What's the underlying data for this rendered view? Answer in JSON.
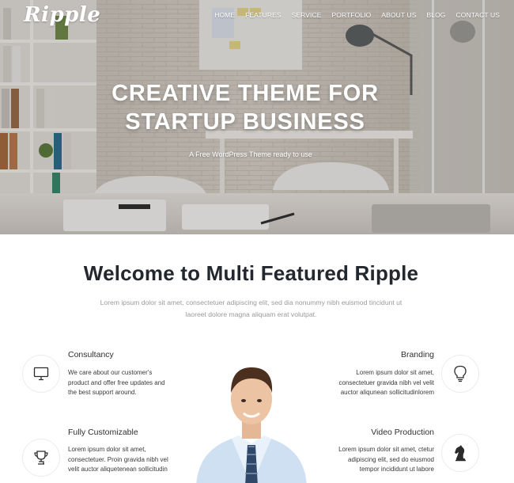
{
  "brand": {
    "logo": "Ripple"
  },
  "nav": [
    "HOME",
    "FEATURES",
    "SERVICE",
    "PORTFOLIO",
    "ABOUT US",
    "BLOG",
    "CONTACT US"
  ],
  "hero": {
    "title_line1": "CREATIVE THEME FOR",
    "title_line2": "STARTUP BUSINESS",
    "subtitle": "A Free WordPress Theme ready to use"
  },
  "welcome": {
    "title": "Welcome to Multi Featured Ripple",
    "text": "Lorem ipsum dolor sit amet, consectetuer adipiscing elit, sed dia nonummy nibh euismod tincidunt ut laoreet dolore magna aliquam erat volutpat."
  },
  "features": {
    "consultancy": {
      "title": "Consultancy",
      "text": "We care about our customer's product and offer free updates and the best support around."
    },
    "customizable": {
      "title": "Fully Customizable",
      "text": "Lorem ipsum dolor sit amet, consectetuer. Proin gravida nibh vel velit auctor aliquetenean sollicitudin"
    },
    "branding": {
      "title": "Branding",
      "text": "Lorem ipsum dolor sit amet, consectetuer gravida nibh vel velit auctor aliqunean sollicitudinlorem"
    },
    "video": {
      "title": "Video Production",
      "text": "Lorem ipsum dolor sit amet, ctetur adipiscing elit, sed do eiusmod tempor incididunt ut labore"
    }
  },
  "icons": {
    "consultancy": "monitor-icon",
    "customizable": "trophy-icon",
    "branding": "lightbulb-icon",
    "video": "chess-knight-icon"
  }
}
